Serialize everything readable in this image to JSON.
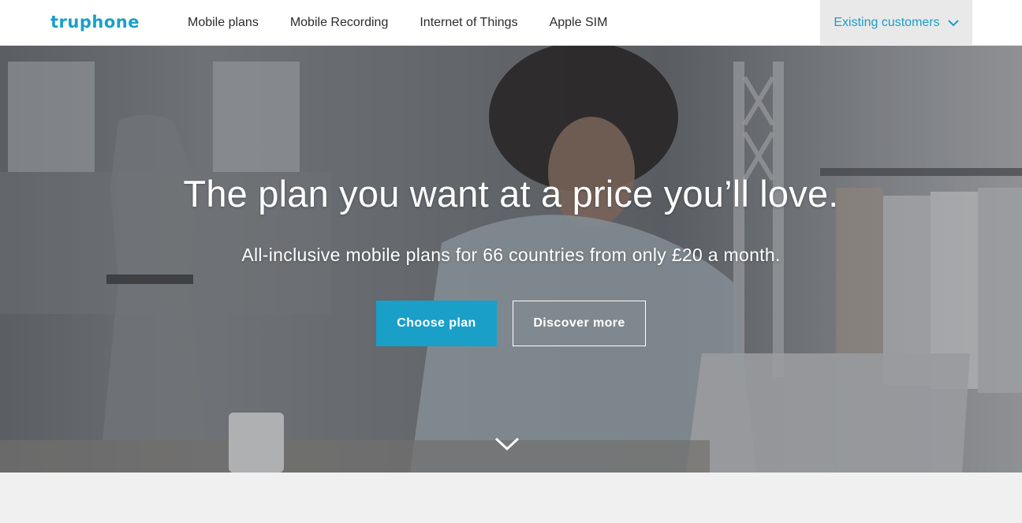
{
  "brand": {
    "logo_text": "truphone",
    "accent_color": "#1a9fc9"
  },
  "nav": {
    "links": [
      "Mobile plans",
      "Mobile Recording",
      "Internet of Things",
      "Apple SIM"
    ],
    "existing_customers": "Existing customers",
    "existing_icon": "chevron-down-icon"
  },
  "hero": {
    "headline": "The plan you want at a price you’ll love.",
    "subline": "All-inclusive mobile plans for 66 countries from only £20 a month.",
    "primary_button": "Choose plan",
    "secondary_button": "Discover more",
    "scroll_icon": "chevron-down-icon"
  }
}
